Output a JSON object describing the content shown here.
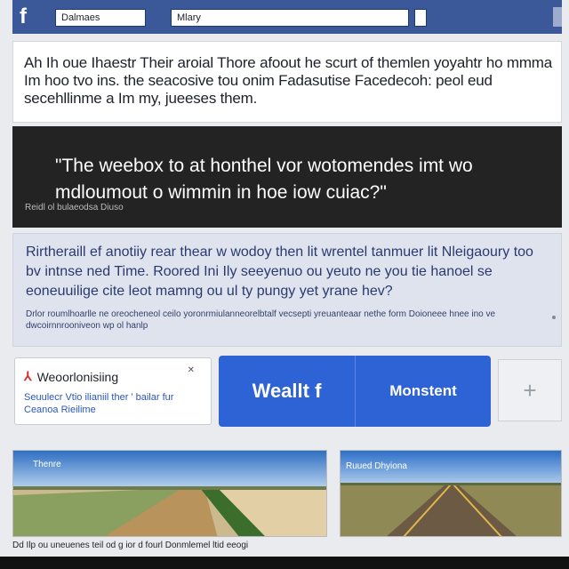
{
  "header": {
    "logo": "f",
    "search_left": "Dalmaes",
    "search_right": "Mlary",
    "brand_color": "#3b5998",
    "icons": [
      "facebook-logo-icon",
      "search-icon"
    ]
  },
  "post": {
    "text": "Ah Ih oue Ihaestr Their aroial Thore afoout he scurt of themlen yoyahtr ho mmma Im hoo tvo ins. the seacosive tou onim Fadasutise Facedecoh: peol eud secehllinme a Im my, jueeses them."
  },
  "banner": {
    "quote": "\"The weebox to at honthel vor wotomendes imt wo mdloumout o wimmin in hoe iow cuiac?\"",
    "meta": "Reidl ol bulaeodsa Diuso"
  },
  "comment": {
    "text": "Rirtheraill ef anotiiy rear thear w wodoy then lit wrentel tanmuer lit Nleigaoury too bv intnse ned Time. Roored Ini Ily seeyenuo ou yeuto ne you tie hanoel se eoneuuilige cite leot mamng ou ul ty pungy yet yrane hev?",
    "small": "Drlor roumlhoarlle ne oreocheneol ceilo yoronrmiulanneorelbtalf vecsepti yreuanteaar nethe form Doioneee hnee ino ve dwcoirnnrooniveon wp ol hanlp"
  },
  "page_card": {
    "title": "Weoorlonisiing",
    "close": "✕",
    "sub": "Seuulecr Vtio ilianiil ther ' bailar fur Ceanoa Rieilime"
  },
  "actions": {
    "left_label": "Weallt f",
    "right_label": "Monstent",
    "plus": "+",
    "button_color": "#2e63d6"
  },
  "photos": {
    "label1": "Thenre",
    "label2": "Ruued Dhyiona"
  },
  "caption": "Dd Ilp ou uneuenes teil od g ior d fourl Donmlemel ltid eeogi"
}
